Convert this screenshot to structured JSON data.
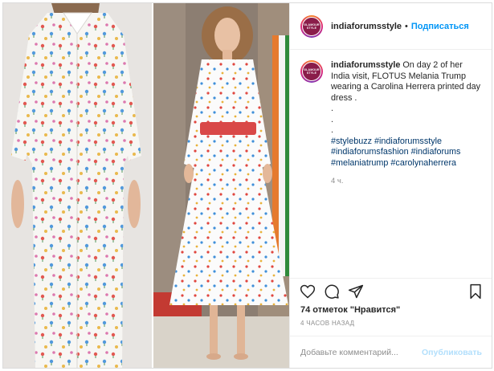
{
  "post": {
    "username": "indiaforumsstyle",
    "avatar_text": [
      "GLAMOUR",
      "STYLE"
    ],
    "follow_label": "Подписаться",
    "header_dot": "•",
    "caption": {
      "username": "indiaforumsstyle",
      "text": "On day 2 of her India visit, FLOTUS Melania Trump wearing a Carolina Herrera printed day dress .",
      "dots": [
        ".",
        ".",
        "."
      ],
      "hashtags": [
        "#stylebuzz",
        "#indiaforumsstyle",
        "#indiaforumsfashion",
        "#indiaforums",
        "#melaniatrump",
        "#carolynaherrera"
      ],
      "time": "4 ч."
    },
    "actions": {
      "like_icon": "heart-icon",
      "comment_icon": "comment-icon",
      "share_icon": "share-icon",
      "save_icon": "bookmark-icon"
    },
    "likes_text": "74 отметок \"Нравится\"",
    "posted_ago": "4 часов назад",
    "comment_placeholder": "Добавьте комментарий...",
    "publish_label": "Опубликовать"
  },
  "colors": {
    "accent": "#0095f6",
    "publish_disabled": "#b2dffc",
    "hashtag": "#00376b",
    "muted": "#8e8e8e",
    "belt": "#d94848"
  }
}
